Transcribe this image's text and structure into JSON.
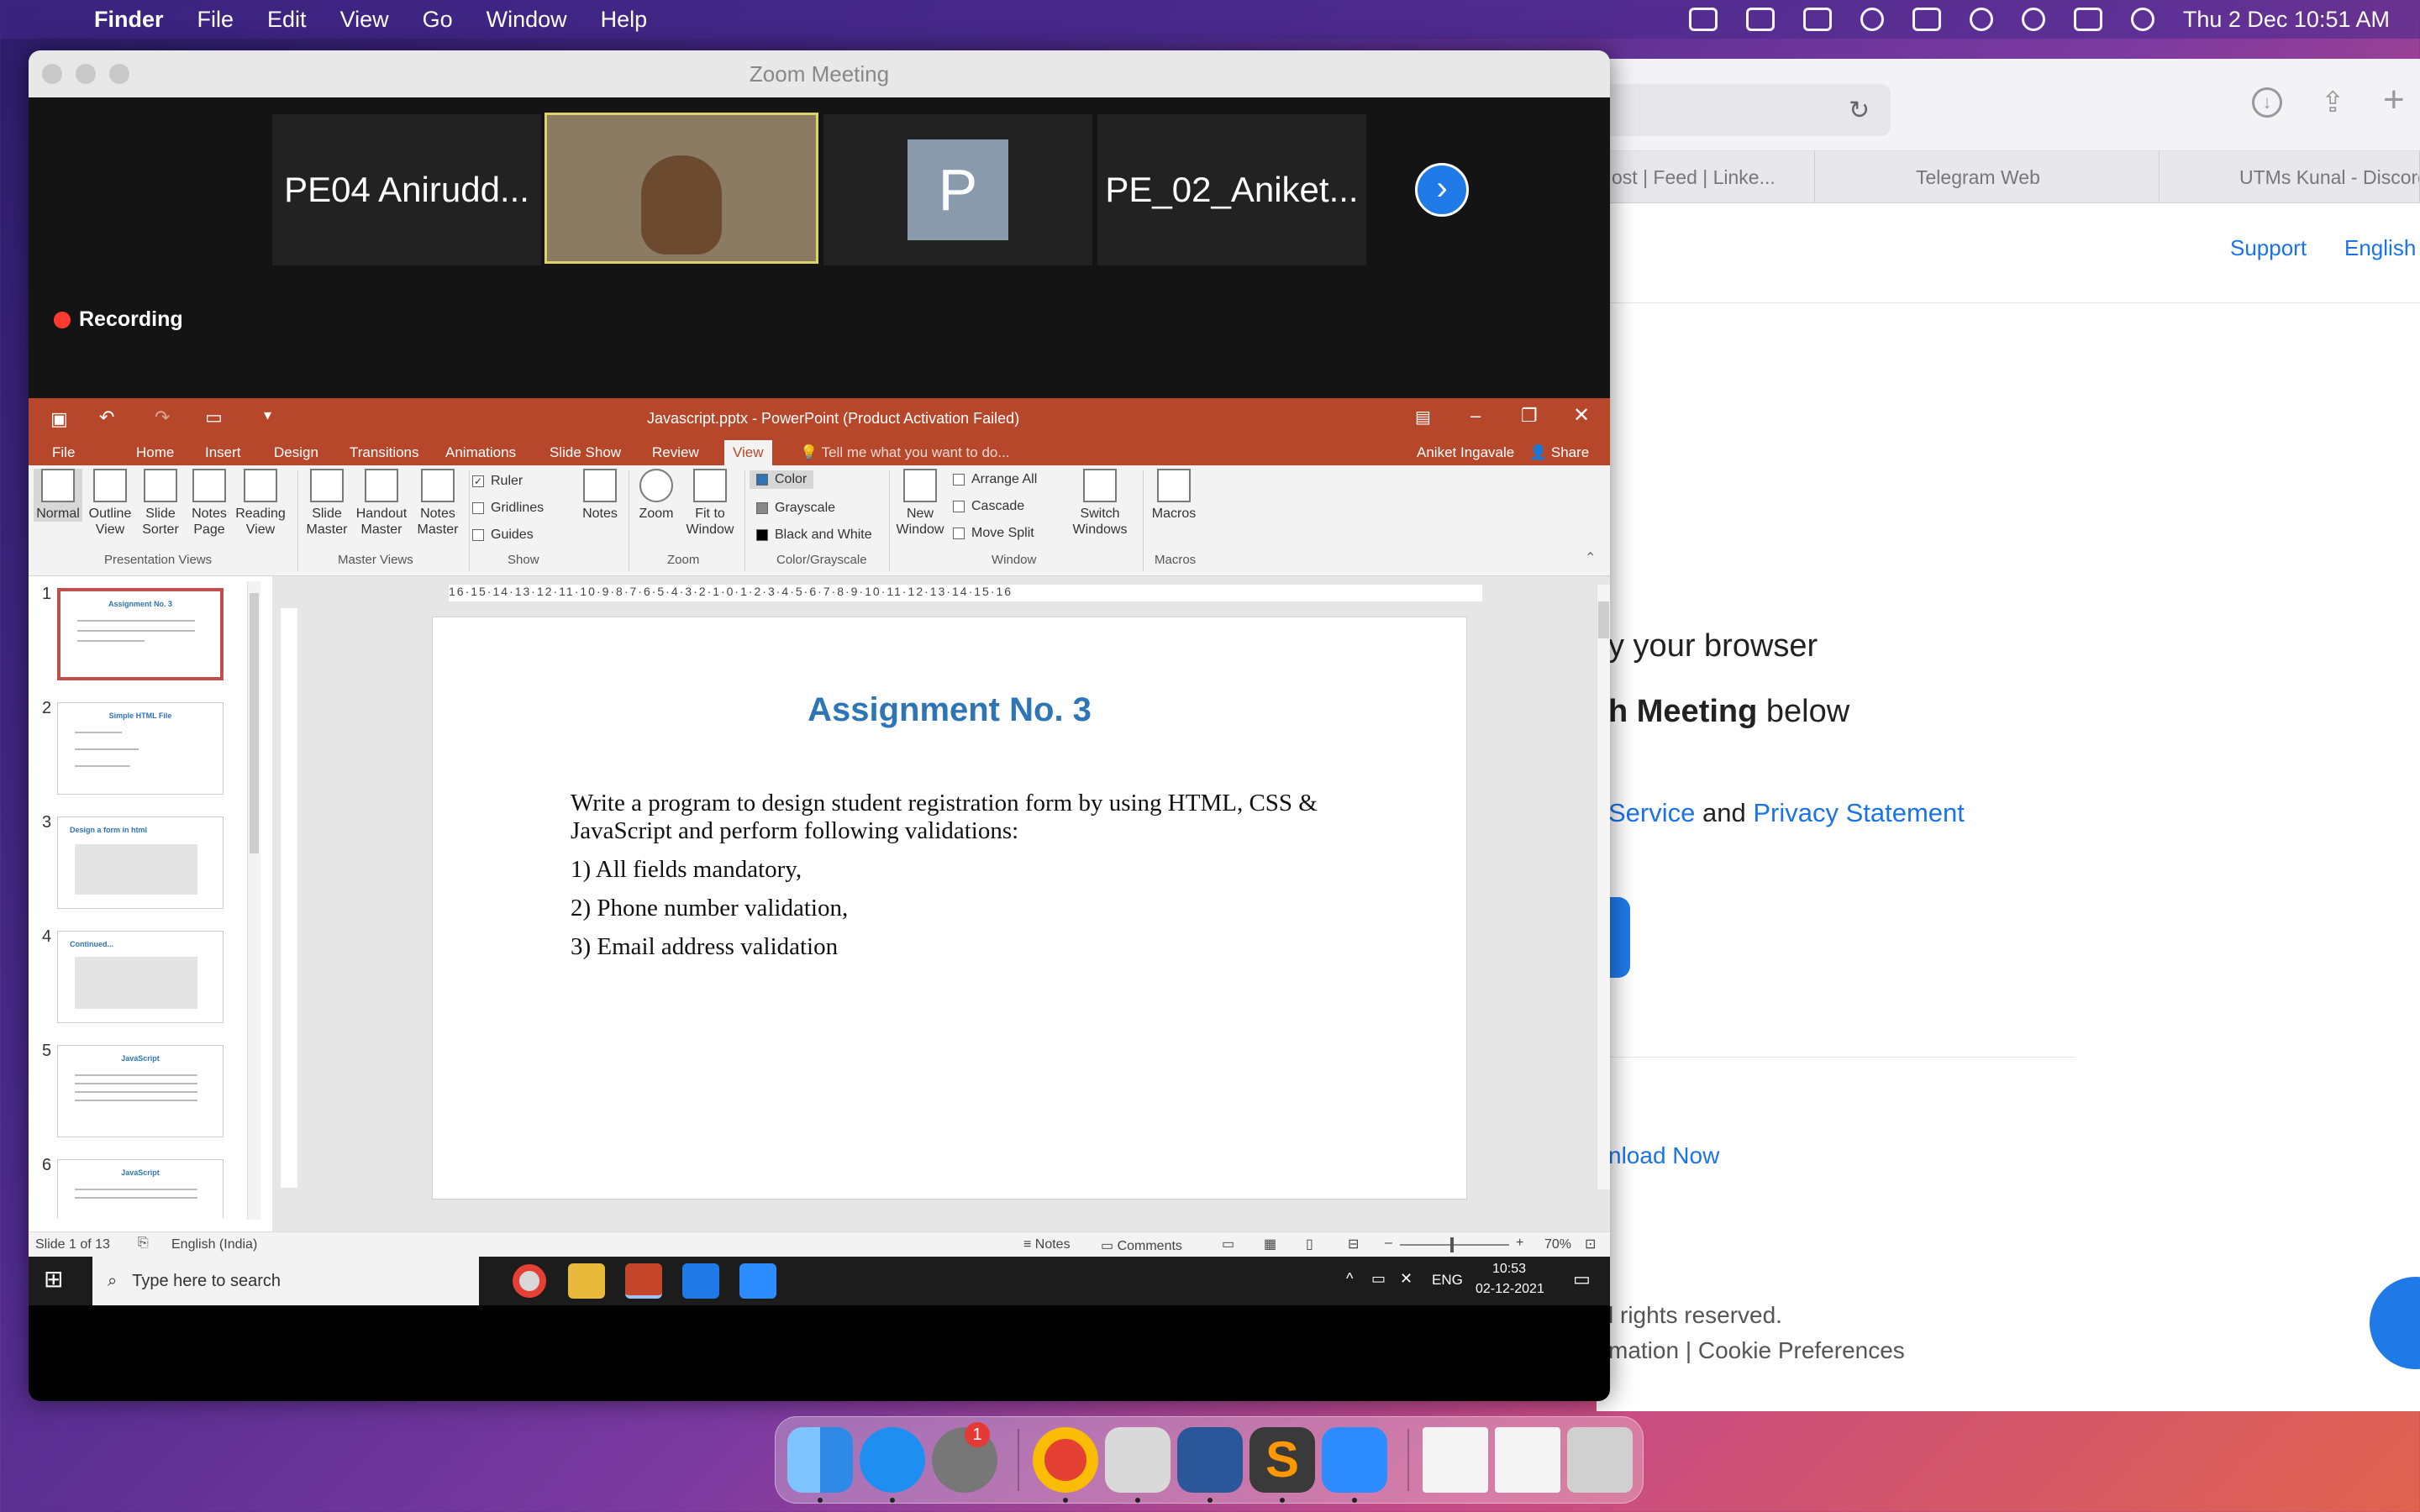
{
  "menubar": {
    "app": "Finder",
    "menus": [
      "File",
      "Edit",
      "View",
      "Go",
      "Window",
      "Help"
    ],
    "clock": "Thu 2 Dec  10:51 AM"
  },
  "browser": {
    "tabs": [
      "ost | Feed | Linke...",
      "Telegram Web",
      "UTMs Kunal - Discord"
    ],
    "support": "Support",
    "language": "English",
    "line1": "y your browser",
    "line2_bold": "h Meeting",
    "line2_rest": " below",
    "tos_link": "Service",
    "tos_and": " and ",
    "privacy_link": "Privacy Statement",
    "download": "nload Now",
    "rights": "l rights reserved.",
    "footer_a": "mation",
    "footer_sep": " | ",
    "footer_b": "Cookie Preferences"
  },
  "zoom": {
    "window_title": "Zoom Meeting",
    "participants": [
      "PE04 Anirudd...",
      "PE_02_Aniket..."
    ],
    "avatar_letter": "P",
    "recording": "Recording"
  },
  "ppt": {
    "title": "Javascript.pptx - PowerPoint (Product Activation Failed)",
    "user": "Aniket Ingavale",
    "share": "Share",
    "tell_me": "Tell me what you want to do...",
    "tabs": [
      "File",
      "Home",
      "Insert",
      "Design",
      "Transitions",
      "Animations",
      "Slide Show",
      "Review",
      "View"
    ],
    "ribbon": {
      "normal": "Normal",
      "outline": "Outline View",
      "sorter": "Slide Sorter",
      "notes_page": "Notes Page",
      "reading": "Reading View",
      "slide_master": "Slide Master",
      "handout_master": "Handout Master",
      "notes_master": "Notes Master",
      "ruler": "Ruler",
      "gridlines": "Gridlines",
      "guides": "Guides",
      "notes": "Notes",
      "zoom": "Zoom",
      "fit": "Fit to Window",
      "color": "Color",
      "grayscale": "Grayscale",
      "bw": "Black and White",
      "new_window": "New Window",
      "arrange": "Arrange All",
      "cascade": "Cascade",
      "move_split": "Move Split",
      "switch": "Switch Windows",
      "macros": "Macros",
      "g_presentation": "Presentation Views",
      "g_master": "Master Views",
      "g_show": "Show",
      "g_zoom": "Zoom",
      "g_color": "Color/Grayscale",
      "g_window": "Window",
      "g_macros": "Macros"
    },
    "thumbs": [
      "Assignment No. 3",
      "Simple HTML File",
      "Design a form in html",
      "Continued...",
      "JavaScript",
      "JavaScript"
    ],
    "slide": {
      "title": "Assignment No. 3",
      "intro": "Write a program to design student registration form by using HTML, CSS & JavaScript and perform following validations:",
      "items": [
        "1) All fields mandatory,",
        "2) Phone number validation,",
        "3) Email address validation"
      ]
    },
    "ruler": "16·15·14·13·12·11·10·9·8·7·6·5·4·3·2·1·0·1·2·3·4·5·6·7·8·9·10·11·12·13·14·15·16",
    "status": {
      "slide": "Slide 1 of 13",
      "lang": "English (India)",
      "notes": "Notes",
      "comments": "Comments",
      "zoom": "70%"
    },
    "taskbar": {
      "search": "Type here to search",
      "lang": "ENG",
      "time": "10:53",
      "date": "02-12-2021"
    }
  },
  "dock": {
    "badge": "1"
  },
  "colors": {
    "ppt_accent": "#b7472a",
    "slide_title": "#2e75b6",
    "zoom_blue": "#1f7ae8"
  }
}
